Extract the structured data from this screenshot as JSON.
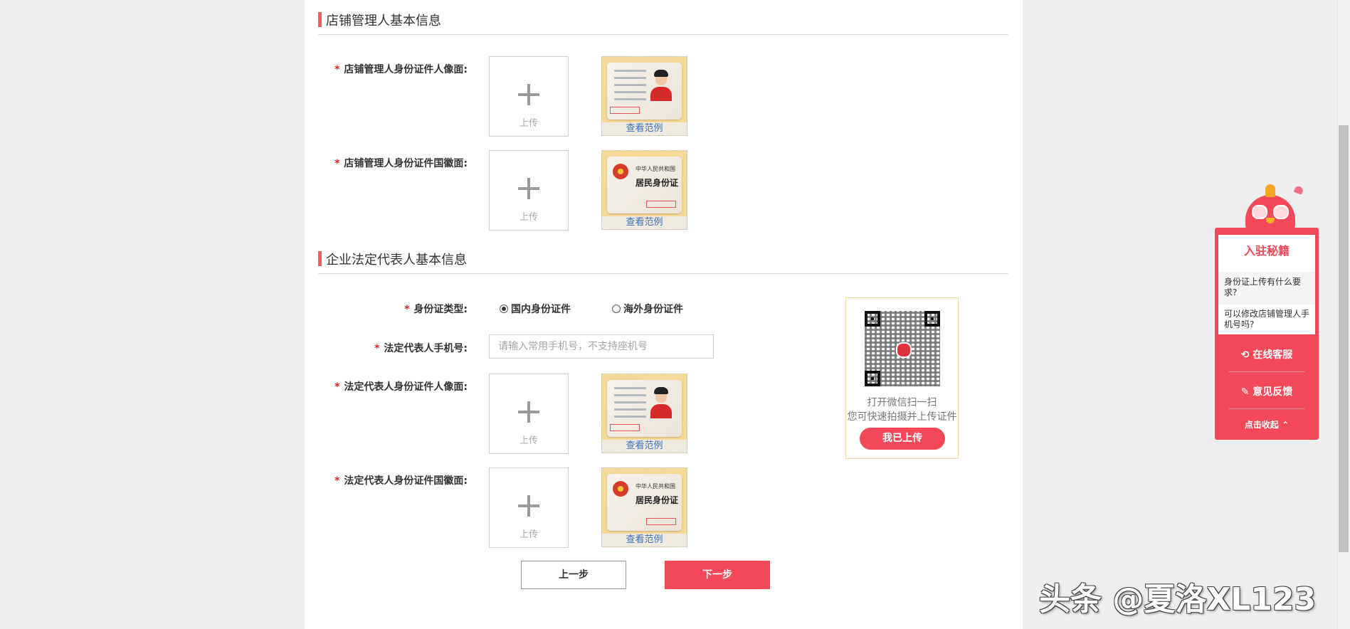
{
  "sections": {
    "manager_title": "店铺管理人基本信息",
    "legal_title": "企业法定代表人基本信息"
  },
  "fields": {
    "required_mark": "*",
    "manager_id_front": "店铺管理人身份证件人像面:",
    "manager_id_back": "店铺管理人身份证件国徽面:",
    "id_type": "身份证类型:",
    "legal_phone": "法定代表人手机号:",
    "legal_id_front": "法定代表人身份证件人像面:",
    "legal_id_back": "法定代表人身份证件国徽面:"
  },
  "upload": {
    "label": "上传",
    "sample_link": "查看范例"
  },
  "id_card_back_text": {
    "country": "中华人民共和国",
    "title": "居民身份证"
  },
  "id_type_options": [
    {
      "label": "国内身份证件",
      "selected": true
    },
    {
      "label": "海外身份证件",
      "selected": false
    }
  ],
  "phone_input": {
    "placeholder": "请输入常用手机号，不支持座机号",
    "value": ""
  },
  "qr_panel": {
    "line1": "打开微信扫一扫",
    "line2": "您可快速拍摄并上传证件",
    "button": "我已上传"
  },
  "buttons": {
    "prev": "上一步",
    "next": "下一步"
  },
  "sidebar": {
    "title": "入驻秘籍",
    "questions": [
      "身份证上传有什么要求?",
      "可以修改店铺管理人手机号吗?"
    ],
    "online_service": "在线客服",
    "feedback": "意见反馈",
    "collapse": "点击收起",
    "collapse_icon": "chevron-up-icon"
  },
  "watermark": "头条 @夏洛XL123",
  "colors": {
    "accent": "#f24858",
    "section_bar": "#f05a5a",
    "link": "#3d6fb6"
  }
}
